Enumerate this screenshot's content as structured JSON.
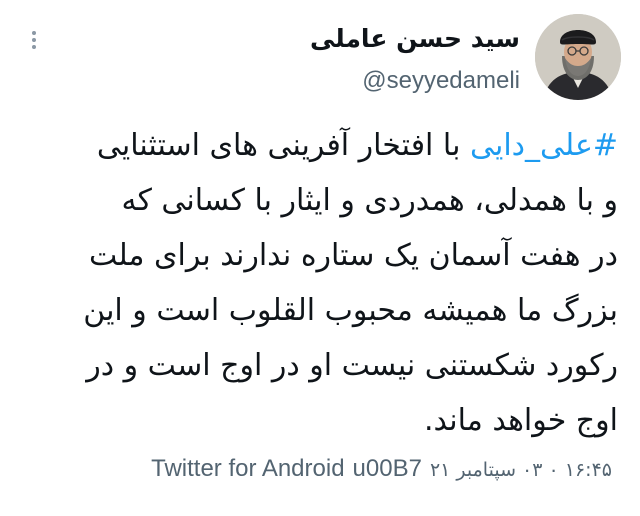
{
  "user": {
    "display_name": "سید حسن عاملی",
    "handle": "@seyyedameli"
  },
  "tweet": {
    "hashtag": "#علی_دایی",
    "line1_rest": " با افتخار آفرینی های استثنایی",
    "lines": [
      "و با همدلی، همدردی و ایثار با کسانی که",
      "در هفت آسمان یک ستاره ندارند برای ملت",
      "بزرگ ما همیشه محبوب القلوب است و این",
      "رکورد شکستنی نیست او در اوج است و در",
      "اوج خواهد ماند."
    ],
    "timestamp": "۱۶:۴۵ ۰ ۰۳ سپتامبر ۲۱",
    "separator": "u00B7",
    "source": "Twitter for Android"
  },
  "colors": {
    "hashtag": "#1d9bf0",
    "secondary_text": "#536471",
    "primary_text": "#0f1419"
  },
  "icons": {
    "more": "more-vertical-icon"
  }
}
